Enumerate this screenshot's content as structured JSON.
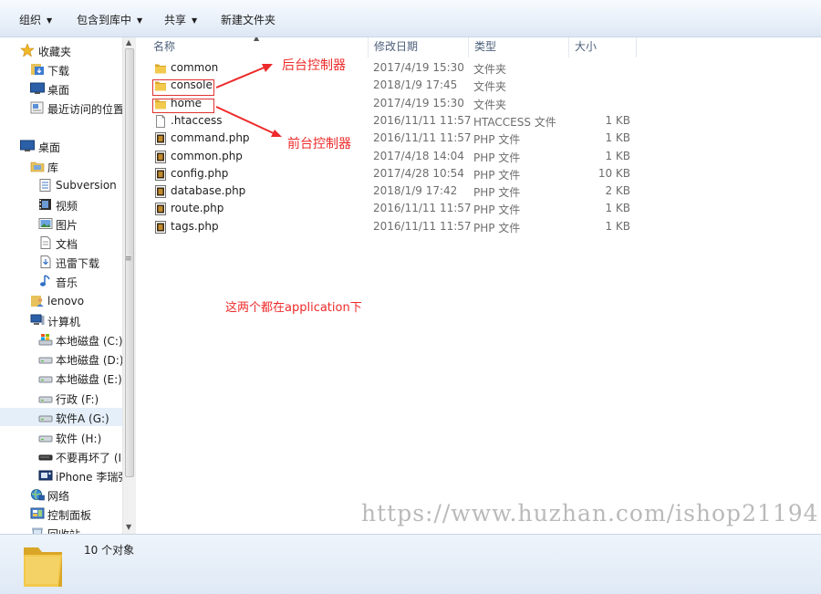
{
  "toolbar": {
    "organize": "组织",
    "include_in_library": "包含到库中",
    "share": "共享",
    "new_folder": "新建文件夹"
  },
  "nav": {
    "favorites": "收藏夹",
    "downloads": "下载",
    "desktop_fav": "桌面",
    "recent": "最近访问的位置",
    "desktop": "桌面",
    "libraries": "库",
    "subversion": "Subversion",
    "videos": "视频",
    "pictures": "图片",
    "documents": "文档",
    "xunlei": "迅雷下载",
    "music": "音乐",
    "lenovo": "lenovo",
    "computer": "计算机",
    "drive_c": "本地磁盘 (C:)",
    "drive_d": "本地磁盘 (D:)",
    "drive_e": "本地磁盘 (E:)",
    "drive_f": "行政 (F:)",
    "drive_g": "软件A (G:)",
    "drive_h": "软件 (H:)",
    "drive_i": "不要再坏了 (I:)",
    "iphone": "iPhone 李瑞强",
    "network": "网络",
    "control_panel": "控制面板",
    "recycle_bin": "回收站"
  },
  "columns": {
    "name": "名称",
    "date": "修改日期",
    "type": "类型",
    "size": "大小"
  },
  "files": [
    {
      "name": "common",
      "date": "2017/4/19 15:30",
      "type": "文件夹",
      "size": "",
      "kind": "folder"
    },
    {
      "name": "console",
      "date": "2018/1/9 17:45",
      "type": "文件夹",
      "size": "",
      "kind": "folder"
    },
    {
      "name": "home",
      "date": "2017/4/19 15:30",
      "type": "文件夹",
      "size": "",
      "kind": "folder"
    },
    {
      "name": ".htaccess",
      "date": "2016/11/11 11:57",
      "type": "HTACCESS 文件",
      "size": "1 KB",
      "kind": "file"
    },
    {
      "name": "command.php",
      "date": "2016/11/11 11:57",
      "type": "PHP 文件",
      "size": "1 KB",
      "kind": "php"
    },
    {
      "name": "common.php",
      "date": "2017/4/18 14:04",
      "type": "PHP 文件",
      "size": "1 KB",
      "kind": "php"
    },
    {
      "name": "config.php",
      "date": "2017/4/28 10:54",
      "type": "PHP 文件",
      "size": "10 KB",
      "kind": "php"
    },
    {
      "name": "database.php",
      "date": "2018/1/9 17:42",
      "type": "PHP 文件",
      "size": "2 KB",
      "kind": "php"
    },
    {
      "name": "route.php",
      "date": "2016/11/11 11:57",
      "type": "PHP 文件",
      "size": "1 KB",
      "kind": "php"
    },
    {
      "name": "tags.php",
      "date": "2016/11/11 11:57",
      "type": "PHP 文件",
      "size": "1 KB",
      "kind": "php"
    }
  ],
  "annotations": {
    "backend": "后台控制器",
    "frontend": "前台控制器",
    "note": "这两个都在application下"
  },
  "watermark": "https://www.huzhan.com/ishop21194",
  "status": {
    "count": "10 个对象"
  },
  "colors": {
    "annotation": "#ee2a2a",
    "selection": "#e5eff9",
    "folder": "#e8b83a"
  }
}
